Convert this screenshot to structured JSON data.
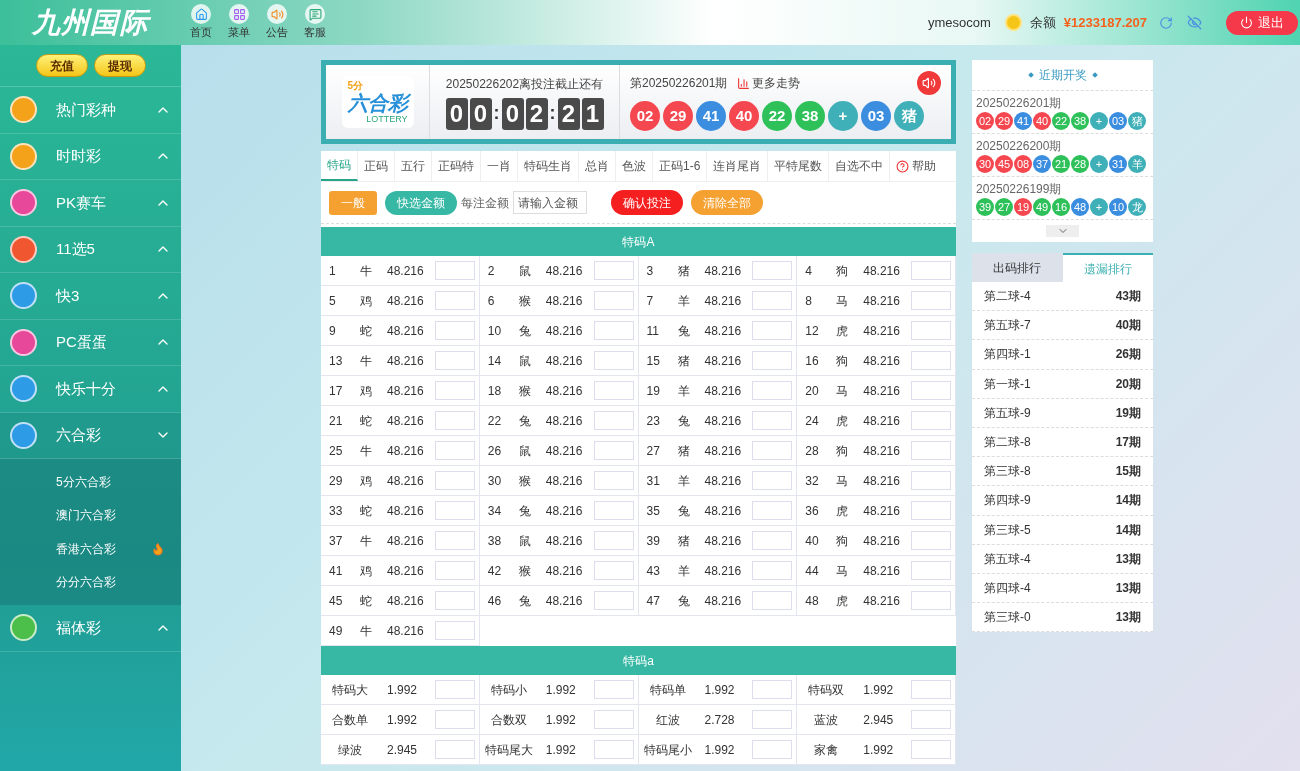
{
  "header": {
    "logo": "九州国际",
    "nav": [
      {
        "label": "首页"
      },
      {
        "label": "菜单"
      },
      {
        "label": "公告"
      },
      {
        "label": "客服"
      }
    ],
    "username": "ymesocom",
    "balance_label": "余额",
    "balance": "¥1233187.207",
    "logout": "退出"
  },
  "sidebar": {
    "buttons": [
      "充值",
      "提现"
    ],
    "items": [
      {
        "label": "热门彩种",
        "color": "#f5a21b",
        "expanded": false
      },
      {
        "label": "时时彩",
        "color": "#f5a21b",
        "expanded": false
      },
      {
        "label": "PK赛车",
        "color": "#e8489a",
        "expanded": false
      },
      {
        "label": "11选5",
        "color": "#f0562f",
        "expanded": false
      },
      {
        "label": "快3",
        "color": "#2e9be6",
        "expanded": false
      },
      {
        "label": "PC蛋蛋",
        "color": "#e8489a",
        "expanded": false
      },
      {
        "label": "快乐十分",
        "color": "#2e9be6",
        "expanded": false
      },
      {
        "label": "六合彩",
        "color": "#2e9be6",
        "expanded": true,
        "children": [
          {
            "label": "5分六合彩",
            "hot": false
          },
          {
            "label": "澳门六合彩",
            "hot": false
          },
          {
            "label": "香港六合彩",
            "hot": true
          },
          {
            "label": "分分六合彩",
            "hot": false
          }
        ]
      },
      {
        "label": "福体彩",
        "color": "#4cbf4a",
        "expanded": false
      }
    ]
  },
  "game": {
    "logo_small": "5分",
    "logo_title": "六合彩",
    "logo_sub": "LOTTERY",
    "deadline": "20250226202离投注截止还有",
    "countdown": [
      "0",
      "0",
      ":",
      "0",
      "2",
      ":",
      "2",
      "1"
    ],
    "last_period": "第20250226201期",
    "trend_link": "更多走势",
    "balls": [
      {
        "text": "02",
        "color": "#f5474f"
      },
      {
        "text": "29",
        "color": "#f5474f"
      },
      {
        "text": "41",
        "color": "#3b8de0"
      },
      {
        "text": "40",
        "color": "#f5474f"
      },
      {
        "text": "22",
        "color": "#2ec15a"
      },
      {
        "text": "38",
        "color": "#2ec15a"
      },
      {
        "text": "+",
        "color": "#3fb0b8"
      },
      {
        "text": "03",
        "color": "#3b8de0"
      },
      {
        "text": "猪",
        "color": "#3fb0b8"
      }
    ]
  },
  "tabs": [
    {
      "label": "特码",
      "selected": true
    },
    {
      "label": "正码",
      "selected": false
    },
    {
      "label": "五行",
      "selected": false
    },
    {
      "label": "正码特",
      "selected": false
    },
    {
      "label": "一肖",
      "selected": false
    },
    {
      "label": "特码生肖",
      "selected": false
    },
    {
      "label": "总肖",
      "selected": false
    },
    {
      "label": "色波",
      "selected": false
    },
    {
      "label": "正码1-6",
      "selected": false
    },
    {
      "label": "连肖尾肖",
      "selected": false
    },
    {
      "label": "平特尾数",
      "selected": false
    },
    {
      "label": "自选不中",
      "selected": false
    }
  ],
  "help": "帮助",
  "toolbar": {
    "modes": [
      {
        "label": "一般",
        "selected": true
      },
      {
        "label": "快选金额",
        "selected": false
      }
    ],
    "amount_label": "每注金额",
    "amount_placeholder": "请输入金额",
    "confirm": "确认投注",
    "clear": "清除全部"
  },
  "section_a": {
    "title": "特码A",
    "items": [
      [
        "1",
        "牛",
        "48.216"
      ],
      [
        "2",
        "鼠",
        "48.216"
      ],
      [
        "3",
        "猪",
        "48.216"
      ],
      [
        "4",
        "狗",
        "48.216"
      ],
      [
        "5",
        "鸡",
        "48.216"
      ],
      [
        "6",
        "猴",
        "48.216"
      ],
      [
        "7",
        "羊",
        "48.216"
      ],
      [
        "8",
        "马",
        "48.216"
      ],
      [
        "9",
        "蛇",
        "48.216"
      ],
      [
        "10",
        "兔",
        "48.216"
      ],
      [
        "11",
        "兔",
        "48.216"
      ],
      [
        "12",
        "虎",
        "48.216"
      ],
      [
        "13",
        "牛",
        "48.216"
      ],
      [
        "14",
        "鼠",
        "48.216"
      ],
      [
        "15",
        "猪",
        "48.216"
      ],
      [
        "16",
        "狗",
        "48.216"
      ],
      [
        "17",
        "鸡",
        "48.216"
      ],
      [
        "18",
        "猴",
        "48.216"
      ],
      [
        "19",
        "羊",
        "48.216"
      ],
      [
        "20",
        "马",
        "48.216"
      ],
      [
        "21",
        "蛇",
        "48.216"
      ],
      [
        "22",
        "兔",
        "48.216"
      ],
      [
        "23",
        "兔",
        "48.216"
      ],
      [
        "24",
        "虎",
        "48.216"
      ],
      [
        "25",
        "牛",
        "48.216"
      ],
      [
        "26",
        "鼠",
        "48.216"
      ],
      [
        "27",
        "猪",
        "48.216"
      ],
      [
        "28",
        "狗",
        "48.216"
      ],
      [
        "29",
        "鸡",
        "48.216"
      ],
      [
        "30",
        "猴",
        "48.216"
      ],
      [
        "31",
        "羊",
        "48.216"
      ],
      [
        "32",
        "马",
        "48.216"
      ],
      [
        "33",
        "蛇",
        "48.216"
      ],
      [
        "34",
        "兔",
        "48.216"
      ],
      [
        "35",
        "兔",
        "48.216"
      ],
      [
        "36",
        "虎",
        "48.216"
      ],
      [
        "37",
        "牛",
        "48.216"
      ],
      [
        "38",
        "鼠",
        "48.216"
      ],
      [
        "39",
        "猪",
        "48.216"
      ],
      [
        "40",
        "狗",
        "48.216"
      ],
      [
        "41",
        "鸡",
        "48.216"
      ],
      [
        "42",
        "猴",
        "48.216"
      ],
      [
        "43",
        "羊",
        "48.216"
      ],
      [
        "44",
        "马",
        "48.216"
      ],
      [
        "45",
        "蛇",
        "48.216"
      ],
      [
        "46",
        "兔",
        "48.216"
      ],
      [
        "47",
        "兔",
        "48.216"
      ],
      [
        "48",
        "虎",
        "48.216"
      ],
      [
        "49",
        "牛",
        "48.216"
      ]
    ]
  },
  "section_b": {
    "title": "特码a",
    "items": [
      [
        "特码大",
        "1.992"
      ],
      [
        "特码小",
        "1.992"
      ],
      [
        "特码单",
        "1.992"
      ],
      [
        "特码双",
        "1.992"
      ],
      [
        "合数单",
        "1.992"
      ],
      [
        "合数双",
        "1.992"
      ],
      [
        "红波",
        "2.728"
      ],
      [
        "蓝波",
        "2.945"
      ],
      [
        "绿波",
        "2.945"
      ],
      [
        "特码尾大",
        "1.992"
      ],
      [
        "特码尾小",
        "1.992"
      ],
      [
        "家禽",
        "1.992"
      ]
    ]
  },
  "recent": {
    "title": "近期开奖",
    "draws": [
      {
        "period": "20250226201期",
        "balls": [
          {
            "text": "02",
            "color": "#f5474f"
          },
          {
            "text": "29",
            "color": "#f5474f"
          },
          {
            "text": "41",
            "color": "#3b8de0"
          },
          {
            "text": "40",
            "color": "#f5474f"
          },
          {
            "text": "22",
            "color": "#2ec15a"
          },
          {
            "text": "38",
            "color": "#2ec15a"
          },
          {
            "text": "+",
            "color": "#3fb0b8"
          },
          {
            "text": "03",
            "color": "#3b8de0"
          },
          {
            "text": "猪",
            "color": "#3fb0b8"
          }
        ]
      },
      {
        "period": "20250226200期",
        "balls": [
          {
            "text": "30",
            "color": "#f5474f"
          },
          {
            "text": "45",
            "color": "#f5474f"
          },
          {
            "text": "08",
            "color": "#f5474f"
          },
          {
            "text": "37",
            "color": "#3b8de0"
          },
          {
            "text": "21",
            "color": "#2ec15a"
          },
          {
            "text": "28",
            "color": "#2ec15a"
          },
          {
            "text": "+",
            "color": "#3fb0b8"
          },
          {
            "text": "31",
            "color": "#3b8de0"
          },
          {
            "text": "羊",
            "color": "#3fb0b8"
          }
        ]
      },
      {
        "period": "20250226199期",
        "balls": [
          {
            "text": "39",
            "color": "#2ec15a"
          },
          {
            "text": "27",
            "color": "#2ec15a"
          },
          {
            "text": "19",
            "color": "#f5474f"
          },
          {
            "text": "49",
            "color": "#2ec15a"
          },
          {
            "text": "16",
            "color": "#2ec15a"
          },
          {
            "text": "48",
            "color": "#3b8de0"
          },
          {
            "text": "+",
            "color": "#3fb0b8"
          },
          {
            "text": "10",
            "color": "#3b8de0"
          },
          {
            "text": "龙",
            "color": "#3fb0b8"
          }
        ]
      }
    ]
  },
  "ranking": {
    "tabs": [
      {
        "label": "出码排行",
        "selected": false
      },
      {
        "label": "遗漏排行",
        "selected": true
      }
    ],
    "rows": [
      [
        "第二球-4",
        "43期"
      ],
      [
        "第五球-7",
        "40期"
      ],
      [
        "第四球-1",
        "26期"
      ],
      [
        "第一球-1",
        "20期"
      ],
      [
        "第五球-9",
        "19期"
      ],
      [
        "第二球-8",
        "17期"
      ],
      [
        "第三球-8",
        "15期"
      ],
      [
        "第四球-9",
        "14期"
      ],
      [
        "第三球-5",
        "14期"
      ],
      [
        "第五球-4",
        "13期"
      ],
      [
        "第四球-4",
        "13期"
      ],
      [
        "第三球-0",
        "13期"
      ]
    ]
  }
}
